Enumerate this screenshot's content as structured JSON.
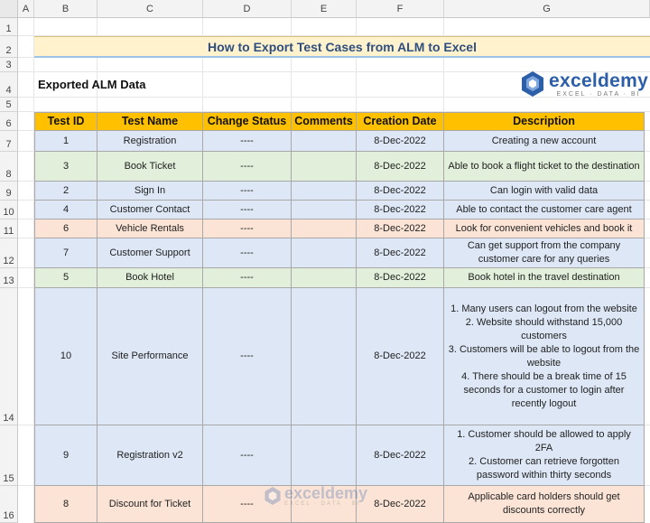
{
  "sheet": {
    "columns": [
      "A",
      "B",
      "C",
      "D",
      "E",
      "F",
      "G"
    ],
    "rows": [
      "1",
      "2",
      "3",
      "4",
      "5",
      "6",
      "7",
      "8",
      "9",
      "10",
      "11",
      "12",
      "13",
      "14",
      "15",
      "16"
    ]
  },
  "title": "How to Export Test Cases from ALM to Excel",
  "subtitle": "Exported ALM Data",
  "logo": {
    "name": "exceldemy",
    "tagline": "EXCEL · DATA · BI"
  },
  "watermark": {
    "name": "exceldemy",
    "tagline": "EXCEL · DATA · BI"
  },
  "colors": {
    "header": "#ffc000",
    "blue": "#dde7f5",
    "green": "#e2efda",
    "orange": "#fbe4d6",
    "title_bg": "#fff2cc"
  },
  "table": {
    "headers": [
      "Test ID",
      "Test Name",
      "Change Status",
      "Comments",
      "Creation Date",
      "Description"
    ],
    "rows": [
      {
        "id": "1",
        "name": "Registration",
        "status": "----",
        "comments": "",
        "date": "8-Dec-2022",
        "desc": "Creating a new account",
        "color": "blue"
      },
      {
        "id": "3",
        "name": "Book Ticket",
        "status": "----",
        "comments": "",
        "date": "8-Dec-2022",
        "desc": "Able to book a flight ticket to the destination",
        "color": "green"
      },
      {
        "id": "2",
        "name": "Sign In",
        "status": "----",
        "comments": "",
        "date": "8-Dec-2022",
        "desc": "Can login with valid data",
        "color": "blue"
      },
      {
        "id": "4",
        "name": "Customer Contact",
        "status": "----",
        "comments": "",
        "date": "8-Dec-2022",
        "desc": "Able to contact the customer care agent",
        "color": "blue"
      },
      {
        "id": "6",
        "name": "Vehicle Rentals",
        "status": "----",
        "comments": "",
        "date": "8-Dec-2022",
        "desc": "Look for convenient vehicles and book it",
        "color": "orange"
      },
      {
        "id": "7",
        "name": "Customer Support",
        "status": "----",
        "comments": "",
        "date": "8-Dec-2022",
        "desc": "Can get support from the company customer care for any queries",
        "color": "blue"
      },
      {
        "id": "5",
        "name": "Book Hotel",
        "status": "----",
        "comments": "",
        "date": "8-Dec-2022",
        "desc": "Book hotel in the travel destination",
        "color": "green"
      },
      {
        "id": "10",
        "name": "Site Performance",
        "status": "----",
        "comments": "",
        "date": "8-Dec-2022",
        "desc": "1. Many users can logout from the website\n2. Website should withstand 15,000 customers\n3. Customers will be able to logout from the website\n4. There should be a break time of 15 seconds for a customer to login after recently logout",
        "color": "blue"
      },
      {
        "id": "9",
        "name": "Registration v2",
        "status": "----",
        "comments": "",
        "date": "8-Dec-2022",
        "desc": "1. Customer should be allowed to apply 2FA\n2. Customer can retrieve forgotten password within thirty seconds",
        "color": "blue"
      },
      {
        "id": "8",
        "name": "Discount for Ticket",
        "status": "----",
        "comments": "",
        "date": "8-Dec-2022",
        "desc": "Applicable card holders should get discounts correctly",
        "color": "orange"
      }
    ]
  }
}
